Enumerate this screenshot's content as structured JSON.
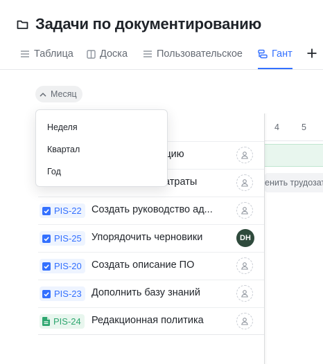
{
  "page": {
    "title": "Задачи по документированию"
  },
  "tabs": [
    {
      "label": "Таблица",
      "icon": "list-icon"
    },
    {
      "label": "Доска",
      "icon": "board-icon"
    },
    {
      "label": "Пользовательское",
      "icon": "list-icon"
    },
    {
      "label": "Гант",
      "icon": "gantt-icon",
      "active": true
    }
  ],
  "toolbar": {
    "month_label": "Месяц"
  },
  "dropdown": {
    "items": [
      "Неделя",
      "Квартал",
      "Год"
    ]
  },
  "gantt": {
    "days": [
      "4",
      "5"
    ],
    "hint_text": "енить трудозат"
  },
  "tasks": [
    {
      "key": "",
      "name": "кцию",
      "type": "task",
      "assignee": ""
    },
    {
      "key": "",
      "name": "атраты",
      "type": "task",
      "assignee": ""
    },
    {
      "key": "PIS-22",
      "name": "Создать руководство ад...",
      "type": "task",
      "assignee": ""
    },
    {
      "key": "PIS-25",
      "name": "Упорядочить черновики",
      "type": "task",
      "assignee": "DH"
    },
    {
      "key": "PIS-20",
      "name": "Создать описание ПО",
      "type": "task",
      "assignee": ""
    },
    {
      "key": "PIS-23",
      "name": "Дополнить базу знаний",
      "type": "task",
      "assignee": ""
    },
    {
      "key": "PIS-24",
      "name": "Редакционная политика",
      "type": "doc",
      "assignee": ""
    }
  ],
  "colors": {
    "accent": "#3370ff",
    "doc_green": "#2ea66f",
    "avatar_bg": "#2f4a3c"
  }
}
